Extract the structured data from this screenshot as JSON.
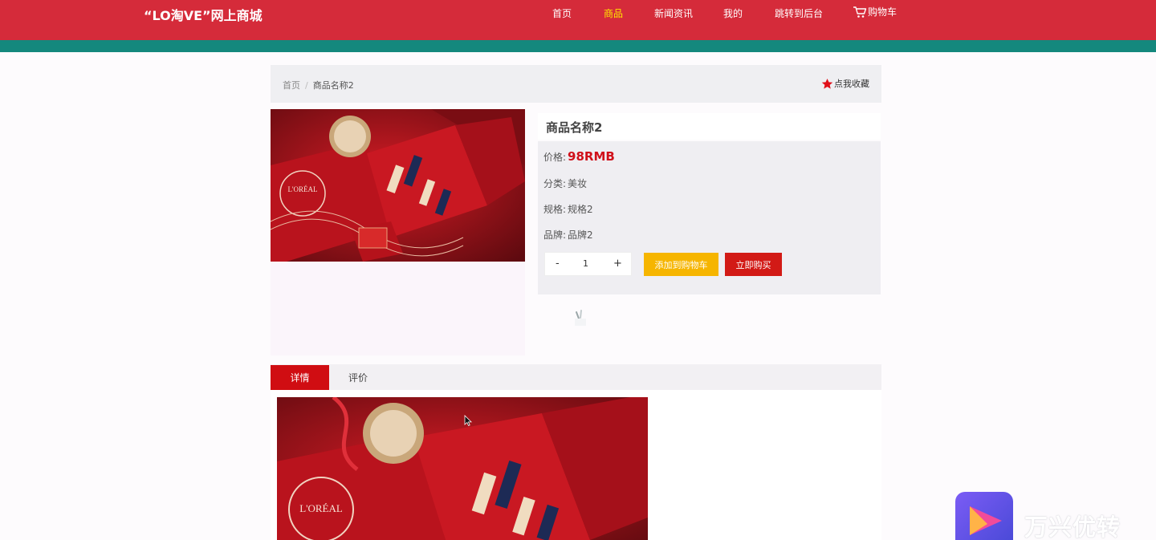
{
  "header": {
    "logo": "“LO淘VE”网上商城",
    "nav": [
      {
        "label": "首页",
        "active": false
      },
      {
        "label": "商品",
        "active": true
      },
      {
        "label": "新闻资讯",
        "active": false
      },
      {
        "label": "我的",
        "active": false
      },
      {
        "label": "跳转到后台",
        "active": false
      }
    ],
    "cart_label": "购物车"
  },
  "breadcrumb": {
    "home": "首页",
    "separator": "/",
    "current": "商品名称2"
  },
  "favorite_label": "点我收藏",
  "product": {
    "title": "商品名称2",
    "price_label": "价格:",
    "price_value": "98RMB",
    "category_label": "分类:",
    "category_value": "美妆",
    "spec_label": "规格:",
    "spec_value": "规格2",
    "brand_label": "品牌:",
    "brand_value": "品牌2",
    "image_caption": "L'ORÉAL"
  },
  "quantity": {
    "minus": "-",
    "value": "1",
    "plus": "+"
  },
  "buttons": {
    "add_to_cart": "添加到购物车",
    "buy_now": "立即购买"
  },
  "tabs": [
    {
      "label": "详情",
      "active": true
    },
    {
      "label": "评价",
      "active": false
    }
  ],
  "watermark": {
    "text": "万兴优转"
  },
  "colors": {
    "header_red": "#d52b3a",
    "teal_strip": "#14887d",
    "nav_active": "#ffe600",
    "price_red": "#d0101a",
    "add_cart_yellow": "#f6b500",
    "buy_red": "#d21a16",
    "tab_active_red": "#d00d12"
  }
}
